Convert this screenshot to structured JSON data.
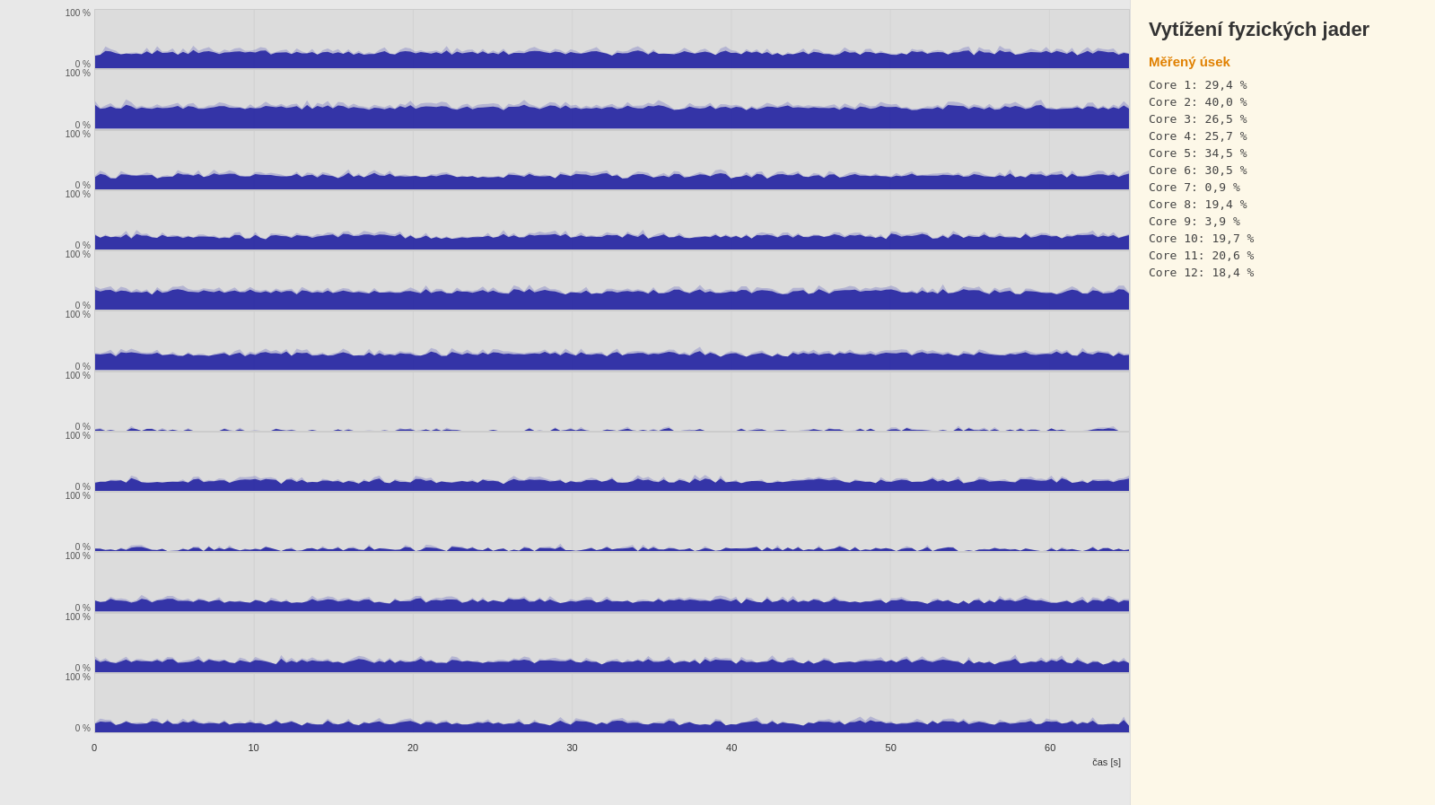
{
  "title": "Vytížení fyzických jader",
  "section": "Měřený úsek",
  "cores": [
    {
      "label": "Core  1:",
      "value": "29,4 %",
      "avg": 29.4
    },
    {
      "label": "Core  2:",
      "value": "40,0 %",
      "avg": 40.0
    },
    {
      "label": "Core  3:",
      "value": "26,5 %",
      "avg": 26.5
    },
    {
      "label": "Core  4:",
      "value": "25,7 %",
      "avg": 25.7
    },
    {
      "label": "Core  5:",
      "value": "34,5 %",
      "avg": 34.5
    },
    {
      "label": "Core  6:",
      "value": "30,5 %",
      "avg": 30.5
    },
    {
      "label": "Core  7:",
      "value": "0,9 %",
      "avg": 0.9
    },
    {
      "label": "Core  8:",
      "value": "19,4 %",
      "avg": 19.4
    },
    {
      "label": "Core  9:",
      "value": "3,9 %",
      "avg": 3.9
    },
    {
      "label": "Core 10:",
      "value": "19,7 %",
      "avg": 19.7
    },
    {
      "label": "Core 11:",
      "value": "20,6 %",
      "avg": 20.6
    },
    {
      "label": "Core 12:",
      "value": "18,4 %",
      "avg": 18.4
    }
  ],
  "xAxis": {
    "label": "čas [s]",
    "ticks": [
      "0",
      "10",
      "20",
      "30",
      "40",
      "50",
      "60"
    ]
  },
  "yLabels": {
    "top": "100 %",
    "bottom": "0 %"
  }
}
